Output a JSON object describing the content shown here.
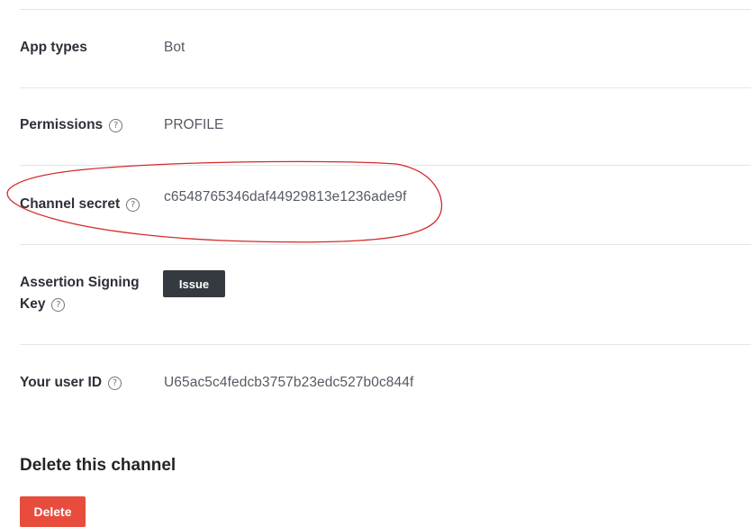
{
  "settings": {
    "app_types": {
      "label": "App types",
      "value": "Bot"
    },
    "permissions": {
      "label": "Permissions",
      "value": "PROFILE"
    },
    "channel_secret": {
      "label": "Channel secret",
      "value": "c6548765346daf44929813e1236ade9f"
    },
    "assertion_signing_key": {
      "label_line1": "Assertion Signing",
      "label_line2": "Key",
      "button_label": "Issue"
    },
    "user_id": {
      "label": "Your user ID",
      "value": "U65ac5c4fedcb3757b23edc527b0c844f"
    }
  },
  "delete_section": {
    "title": "Delete this channel",
    "button_label": "Delete"
  },
  "icons": {
    "help": "help-circle-icon"
  },
  "colors": {
    "issue_button": "#343a40",
    "delete_button": "#e74c3c",
    "annotation": "#d42a2a"
  }
}
